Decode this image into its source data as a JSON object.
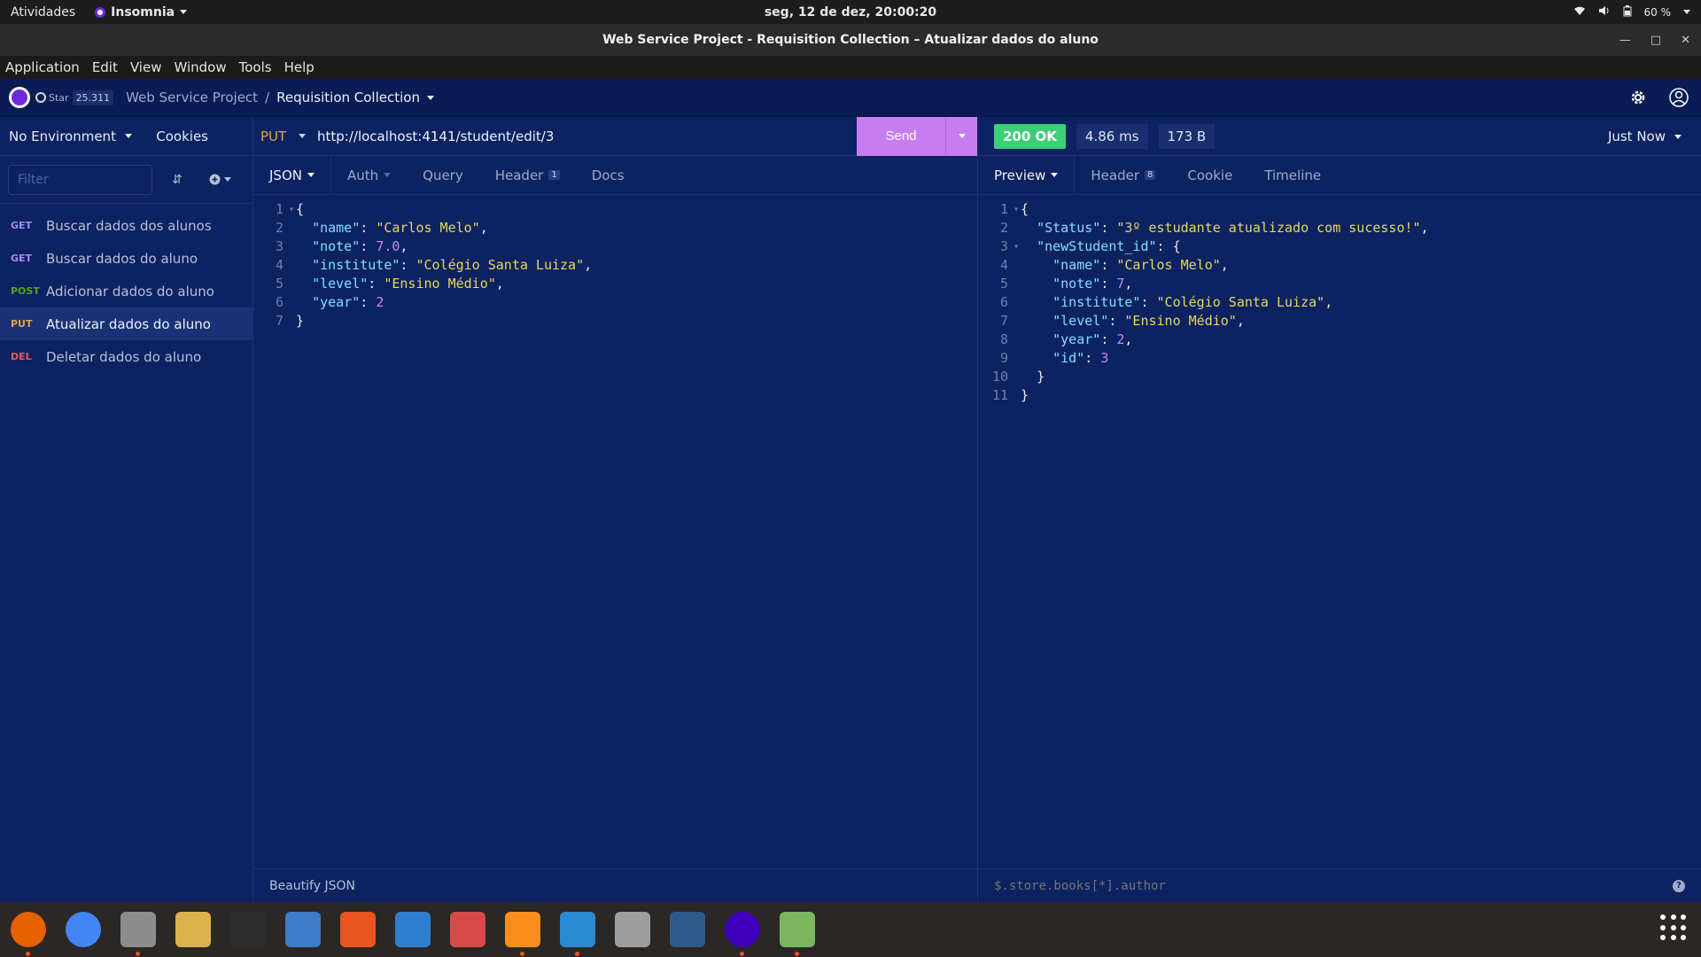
{
  "topbar": {
    "activities": "Atividades",
    "app_name": "Insomnia",
    "clock": "seg, 12 de dez, 20:00:20",
    "battery": "60 %"
  },
  "titlebar": {
    "title": "Web Service Project - Requisition Collection – Atualizar dados do aluno"
  },
  "menubar": {
    "items": [
      "Application",
      "Edit",
      "View",
      "Window",
      "Tools",
      "Help"
    ]
  },
  "header": {
    "star_label": "Star",
    "star_count": "25.311",
    "project": "Web Service Project",
    "collection": "Requisition Collection"
  },
  "sidebar": {
    "environment": "No Environment",
    "cookies": "Cookies",
    "filter_placeholder": "Filter",
    "requests": [
      {
        "method": "GET",
        "label": "Buscar dados dos alunos",
        "color": "#a78bfa"
      },
      {
        "method": "GET",
        "label": "Buscar dados do aluno",
        "color": "#a78bfa"
      },
      {
        "method": "POST",
        "label": "Adicionar dados do aluno",
        "color": "#59a210"
      },
      {
        "method": "PUT",
        "label": "Atualizar dados do aluno",
        "color": "#e6a33e"
      },
      {
        "method": "DEL",
        "label": "Deletar dados do aluno",
        "color": "#ea5b5b"
      }
    ]
  },
  "request": {
    "method": "PUT",
    "url": "http://localhost:4141/student/edit/3",
    "send_label": "Send",
    "tabs": {
      "body": "JSON",
      "auth": "Auth",
      "query": "Query",
      "header": "Header",
      "header_count": "1",
      "docs": "Docs"
    },
    "body_lines": [
      "{",
      "  \"name\": \"Carlos Melo\",",
      "  \"note\": 7.0,",
      "  \"institute\": \"Colégio Santa Luiza\",",
      "  \"level\": \"Ensino Médio\",",
      "  \"year\": 2",
      "}"
    ],
    "footer": "Beautify JSON"
  },
  "response": {
    "status": "200 OK",
    "time": "4.86 ms",
    "size": "173 B",
    "when": "Just Now",
    "tabs": {
      "preview": "Preview",
      "header": "Header",
      "header_count": "8",
      "cookie": "Cookie",
      "timeline": "Timeline"
    },
    "body_lines": [
      "{",
      "  \"Status\": \"3º estudante atualizado com sucesso!\",",
      "  \"newStudent_id\": {",
      "    \"name\": \"Carlos Melo\",",
      "    \"note\": 7,",
      "    \"institute\": \"Colégio Santa Luiza\",",
      "    \"level\": \"Ensino Médio\",",
      "    \"year\": 2,",
      "    \"id\": 3",
      "  }",
      "}"
    ],
    "filter_placeholder": "$.store.books[*].author"
  },
  "dock": {
    "apps": [
      {
        "name": "firefox-icon",
        "color": "#e66000",
        "running": true
      },
      {
        "name": "chrome-icon",
        "color": "#4285f4",
        "running": false
      },
      {
        "name": "files-icon",
        "color": "#8d8d8d",
        "running": true
      },
      {
        "name": "rhythmbox-icon",
        "color": "#d9b34a",
        "running": false
      },
      {
        "name": "terminal-icon",
        "color": "#2d2d2d",
        "running": false
      },
      {
        "name": "help-icon",
        "color": "#3d7cc9",
        "running": false
      },
      {
        "name": "software-icon",
        "color": "#e95420",
        "running": false
      },
      {
        "name": "writer-icon",
        "color": "#2f7fd0",
        "running": false
      },
      {
        "name": "document-viewer-icon",
        "color": "#d84a4a",
        "running": false
      },
      {
        "name": "sublime-icon",
        "color": "#f98e1d",
        "running": true
      },
      {
        "name": "vscode-icon",
        "color": "#2a8ad4",
        "running": true
      },
      {
        "name": "database-icon",
        "color": "#9e9e9e",
        "running": false
      },
      {
        "name": "mysql-workbench-icon",
        "color": "#2d5a8a",
        "running": false
      },
      {
        "name": "insomnia-icon",
        "color": "#4000bf",
        "running": true
      },
      {
        "name": "image-viewer-icon",
        "color": "#7bb661",
        "running": true
      }
    ]
  }
}
